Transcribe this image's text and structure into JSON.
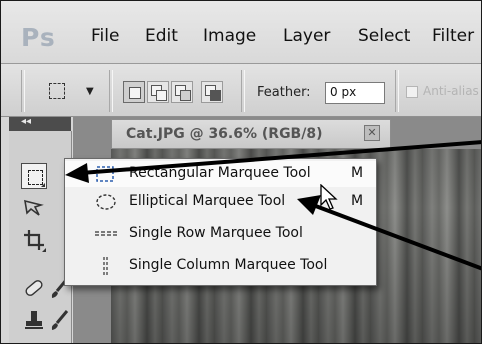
{
  "app": {
    "logo": "Ps"
  },
  "menu": {
    "items": [
      "File",
      "Edit",
      "Image",
      "Layer",
      "Select",
      "Filter"
    ]
  },
  "options": {
    "feather_label": "Feather:",
    "feather_value": "0 px",
    "antialias_label": "Anti-alias"
  },
  "document": {
    "tab_title": "Cat.JPG @ 36.6% (RGB/8)",
    "close_glyph": "✕"
  },
  "flyout": {
    "items": [
      {
        "label": "Rectangular Marquee Tool",
        "shortcut": "M",
        "icon": "rectangular-marquee-icon"
      },
      {
        "label": "Elliptical Marquee Tool",
        "shortcut": "M",
        "icon": "elliptical-marquee-icon"
      },
      {
        "label": "Single Row Marquee Tool",
        "shortcut": "",
        "icon": "single-row-marquee-icon"
      },
      {
        "label": "Single Column Marquee Tool",
        "shortcut": "",
        "icon": "single-column-marquee-icon"
      }
    ]
  },
  "tools": {
    "items": [
      "rectangular-marquee-icon",
      "lasso-icon",
      "crop-icon",
      "healing-brush-icon",
      "brush-icon",
      "stamp-icon",
      "history-brush-icon"
    ]
  },
  "colors": {
    "menubar": "#e3e3e3",
    "tools_header": "#4c4c4c",
    "flyout_bg": "#f1f1f1",
    "arrow": "#000000"
  }
}
